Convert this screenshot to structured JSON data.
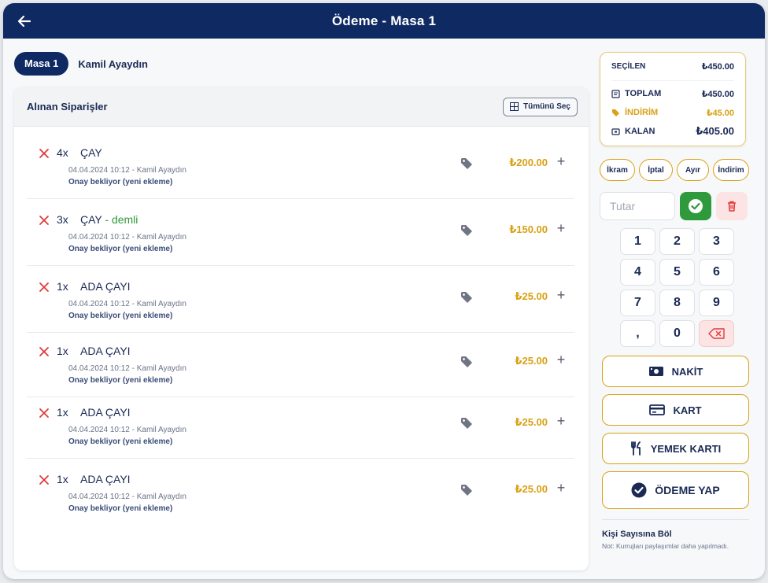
{
  "header": {
    "title": "Ödeme - Masa 1"
  },
  "tabs": [
    {
      "label": "Masa 1"
    },
    {
      "label": "Kamil Ayaydın"
    }
  ],
  "orders": {
    "title": "Alınan Siparişler",
    "select_all_label": "Tümünü Seç",
    "items": [
      {
        "qty": "4x",
        "name": "ÇAY",
        "variant": "",
        "meta": "04.04.2024 10:12 - Kamil Ayaydın",
        "status": "Onay bekliyor (yeni ekleme)",
        "price": "₺200.00"
      },
      {
        "qty": "3x",
        "name": "ÇAY",
        "variant": " - demli",
        "meta": "04.04.2024 10:12 - Kamil Ayaydın",
        "status": "Onay bekliyor (yeni ekleme)",
        "price": "₺150.00"
      },
      {
        "qty": "1x",
        "name": "ADA ÇAYI",
        "variant": "",
        "meta": "04.04.2024 10:12 - Kamil Ayaydın",
        "status": "Onay bekliyor (yeni ekleme)",
        "price": "₺25.00"
      },
      {
        "qty": "1x",
        "name": "ADA ÇAYI",
        "variant": "",
        "meta": "04.04.2024 10:12 - Kamil Ayaydın",
        "status": "Onay bekliyor (yeni ekleme)",
        "price": "₺25.00"
      },
      {
        "qty": "1x",
        "name": "ADA ÇAYI",
        "variant": "",
        "meta": "04.04.2024 10:12 - Kamil Ayaydın",
        "status": "Onay bekliyor (yeni ekleme)",
        "price": "₺25.00"
      },
      {
        "qty": "1x",
        "name": "ADA ÇAYI",
        "variant": "",
        "meta": "04.04.2024 10:12 - Kamil Ayaydın",
        "status": "Onay bekliyor (yeni ekleme)",
        "price": "₺25.00"
      }
    ]
  },
  "summary": {
    "selected_label": "SEÇİLEN",
    "selected_value": "₺450.00",
    "total_label": "TOPLAM",
    "total_value": "₺450.00",
    "discount_label": "İNDİRİM",
    "discount_value": "₺45.00",
    "remaining_label": "KALAN",
    "remaining_value": "₺405.00"
  },
  "actions": {
    "ikram": "İkram",
    "iptal": "İptal",
    "ayir": "Ayır",
    "indirim": "İndirim"
  },
  "amount": {
    "placeholder": "Tutar"
  },
  "keypad": [
    "1",
    "2",
    "3",
    "4",
    "5",
    "6",
    "7",
    "8",
    "9",
    ",",
    "0"
  ],
  "payments": {
    "cash": "NAKİT",
    "card": "KART",
    "meal_card": "YEMEK KARTI",
    "pay": "ÖDEME YAP"
  },
  "split": {
    "title": "Kişi Sayısına Böl",
    "note": "Not: Kurrujları paylaşımlar daha yapılmadı."
  },
  "colors": {
    "primary": "#0f2a63",
    "accent": "#d9a114",
    "success": "#2e9a3c",
    "danger": "#e03b3b"
  }
}
